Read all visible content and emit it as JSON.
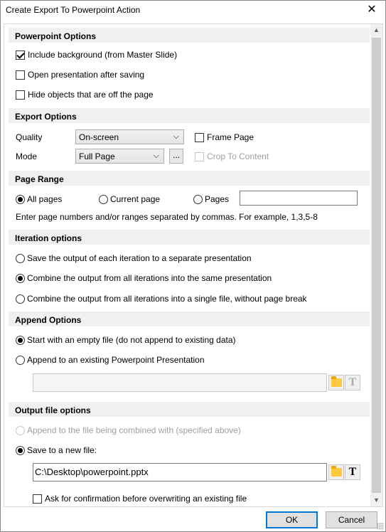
{
  "window": {
    "title": "Create Export To Powerpoint Action",
    "close_glyph": "✕"
  },
  "powerpoint_options": {
    "header": "Powerpoint Options",
    "include_background": {
      "label": "Include background (from Master Slide)",
      "checked": true
    },
    "open_after_saving": {
      "label": "Open presentation after saving",
      "checked": false
    },
    "hide_objects": {
      "label": "Hide objects that are off the page",
      "checked": false
    }
  },
  "export_options": {
    "header": "Export Options",
    "quality_label": "Quality",
    "quality_value": "On-screen",
    "mode_label": "Mode",
    "mode_value": "Full Page",
    "mode_more_button": "...",
    "frame_page": {
      "label": "Frame Page",
      "checked": false
    },
    "crop_to_content": {
      "label": "Crop To Content",
      "checked": false,
      "enabled": false
    }
  },
  "page_range": {
    "header": "Page Range",
    "all_pages": "All pages",
    "current_page": "Current page",
    "pages": "Pages",
    "selected": "all_pages",
    "pages_input_value": "",
    "hint": "Enter page numbers and/or ranges separated by commas. For example, 1,3,5-8"
  },
  "iteration_options": {
    "header": "Iteration options",
    "separate": "Save the output of each iteration to a separate presentation",
    "combine_same": "Combine the output from all iterations into the same presentation",
    "combine_single": "Combine the output from all iterations into a single file, without page break",
    "selected": "combine_same"
  },
  "append_options": {
    "header": "Append Options",
    "start_empty": "Start with an empty file (do not append to existing data)",
    "append_existing": "Append to an existing Powerpoint Presentation",
    "selected": "start_empty",
    "path_value": ""
  },
  "output_file_options": {
    "header": "Output file options",
    "append_combined": "Append to the file being combined with (specified above)",
    "save_new": "Save to a new file:",
    "selected": "save_new",
    "path_value": "C:\\Desktop\\powerpoint.pptx",
    "ask_confirm": {
      "label": "Ask for confirmation before overwriting an existing file",
      "checked": false
    }
  },
  "buttons": {
    "ok": "OK",
    "cancel": "Cancel"
  },
  "icons": {
    "folder": "folder-icon",
    "text": "T",
    "dropdown": "⌵"
  },
  "colors": {
    "accent": "#0078d7",
    "section_bg": "#f0f0f0",
    "folder": "#ffc83d"
  }
}
